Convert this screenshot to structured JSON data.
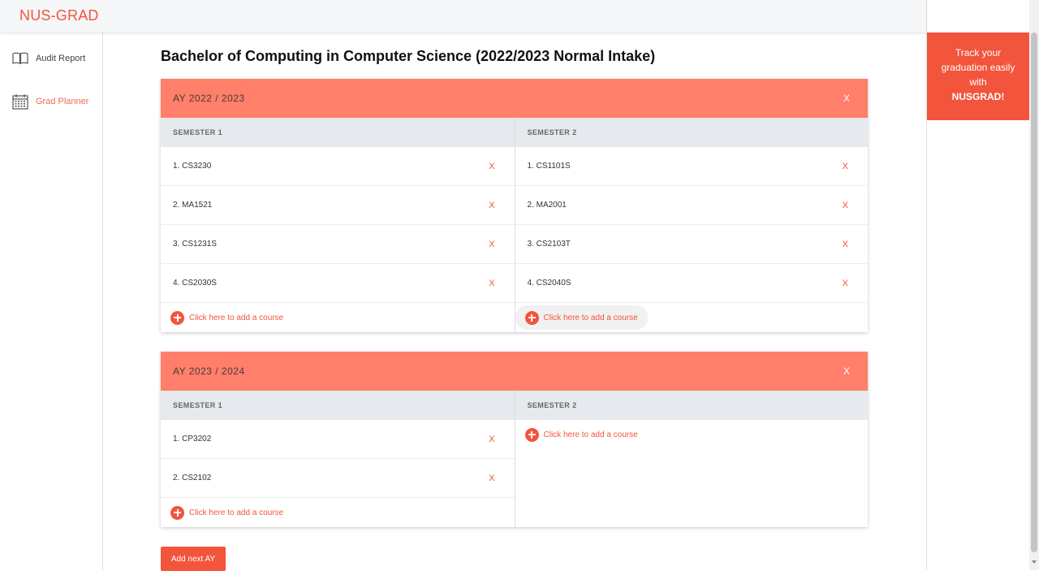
{
  "app": {
    "logo": "NUS-GRAD"
  },
  "sidebar": {
    "items": [
      {
        "label": "Audit Report",
        "icon": "book-icon",
        "active": false
      },
      {
        "label": "Grad Planner",
        "icon": "calendar-icon",
        "active": true
      }
    ]
  },
  "main": {
    "title": "Bachelor of Computing in Computer Science (2022/2023 Normal Intake)",
    "add_ay_label": "Add next AY",
    "add_course_label": "Click here to add a course",
    "academic_years": [
      {
        "title": "AY 2022 / 2023",
        "close": "X",
        "semesters": [
          {
            "title": "SEMESTER 1",
            "courses": [
              "1. CS3230",
              "2. MA1521",
              "3. CS1231S",
              "4. CS2030S"
            ]
          },
          {
            "title": "SEMESTER 2",
            "courses": [
              "1. CS1101S",
              "2. MA2001",
              "3. CS2103T",
              "4. CS2040S"
            ]
          }
        ]
      },
      {
        "title": "AY 2023 / 2024",
        "close": "X",
        "semesters": [
          {
            "title": "SEMESTER 1",
            "courses": [
              "1. CP3202",
              "2. CS2102"
            ]
          },
          {
            "title": "SEMESTER 2",
            "courses": []
          }
        ]
      }
    ],
    "remove_label": "X"
  },
  "promo": {
    "line1": "Track your",
    "line2": "graduation easily",
    "line3": "with",
    "brand": "NUSGRAD!"
  },
  "colors": {
    "accent": "#f2553c",
    "ay_header": "#ff7f6b",
    "semester_header": "#e6e9ee"
  }
}
